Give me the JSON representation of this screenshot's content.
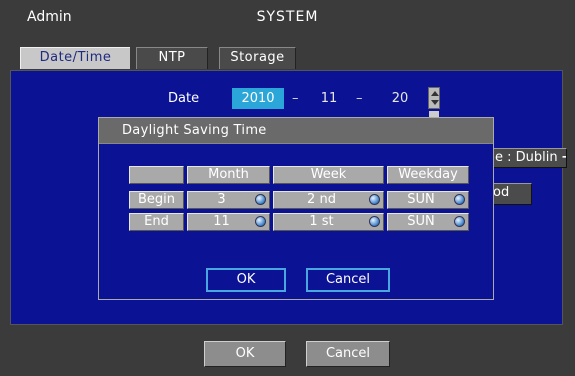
{
  "header": {
    "left": "Admin",
    "title": "SYSTEM"
  },
  "tabs": [
    {
      "label": "Date/Time",
      "active": true
    },
    {
      "label": "NTP",
      "active": false
    },
    {
      "label": "Storage",
      "active": false
    }
  ],
  "date": {
    "label": "Date",
    "year": "2010",
    "month": "11",
    "day": "20",
    "separator": "–"
  },
  "background_controls": {
    "timezone_text": "e : Dublin",
    "period_text": "od"
  },
  "dialog": {
    "title": "Daylight Saving Time",
    "headers": [
      "Month",
      "Week",
      "Weekday"
    ],
    "rows": [
      {
        "label": "Begin",
        "month": "3",
        "week": "2 nd",
        "weekday": "SUN"
      },
      {
        "label": "End",
        "month": "11",
        "week": "1 st",
        "weekday": "SUN"
      }
    ],
    "ok_label": "OK",
    "cancel_label": "Cancel"
  },
  "footer": {
    "ok_label": "OK",
    "cancel_label": "Cancel"
  },
  "colors": {
    "panel": "#0b1294",
    "frame": "#3b3b3b",
    "highlight": "#2aa7d8",
    "button_border": "#4aa6e0"
  }
}
